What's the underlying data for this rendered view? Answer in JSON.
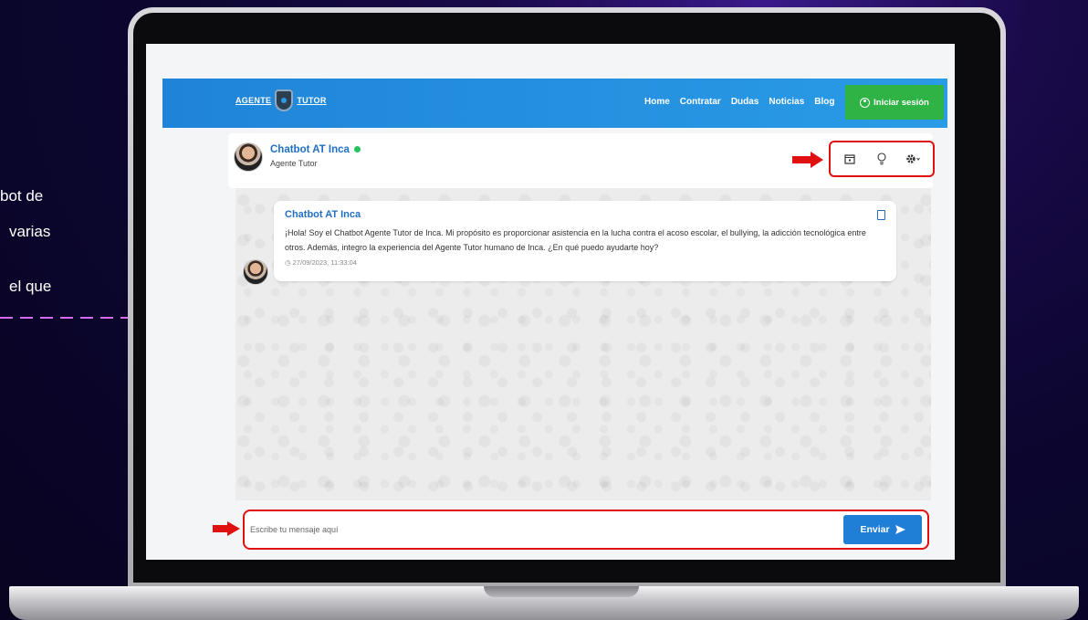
{
  "side_text": {
    "line1": "bot de",
    "line2": "varias",
    "line3": "el que"
  },
  "navbar": {
    "logo_left": "AGENTE",
    "logo_right": "TUTOR",
    "links": [
      "Home",
      "Contratar",
      "Dudas",
      "Noticias",
      "Blog"
    ],
    "login_label": "Iniciar sesión"
  },
  "chat": {
    "bot_name": "Chatbot AT Inca",
    "bot_role": "Agente Tutor",
    "online_color": "#22c55e",
    "tools": [
      "calendar-icon",
      "lightbulb-icon",
      "gear-icon"
    ]
  },
  "message": {
    "sender": "Chatbot AT Inca",
    "text": "¡Hola! Soy el Chatbot Agente Tutor de Inca. Mi propósito es proporcionar asistencia en la lucha contra el acoso escolar, el bullying, la adicción tecnológica entre otros. Además, integro la experiencia del Agente Tutor humano de Inca. ¿En qué puedo ayudarte hoy?",
    "timestamp": "27/09/2023, 11:33:04"
  },
  "composer": {
    "placeholder": "Escribe tu mensaje aquí",
    "send_label": "Enviar"
  },
  "colors": {
    "navbar": "#1f84d8",
    "login_button": "#2fb344",
    "send_button": "#1f7fd6",
    "highlight": "#e01010",
    "annotation_arrow": "#d36bf0"
  }
}
